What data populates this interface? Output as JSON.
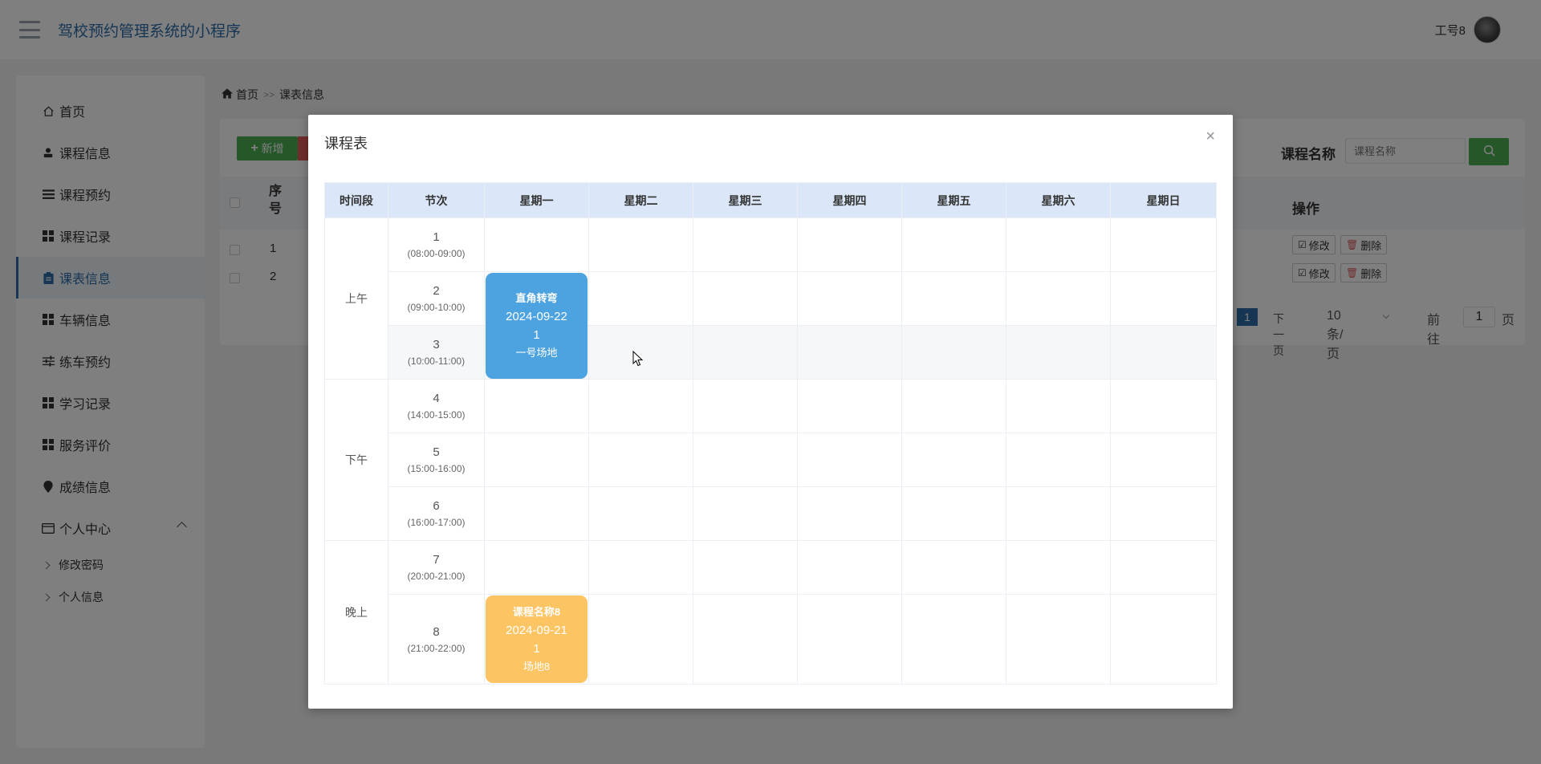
{
  "header": {
    "title": "驾校预约管理系统的小程序",
    "username": "工号8"
  },
  "sidebar": {
    "items": [
      {
        "label": "首页",
        "icon": "home-icon"
      },
      {
        "label": "课程信息",
        "icon": "user-icon"
      },
      {
        "label": "课程预约",
        "icon": "list-icon"
      },
      {
        "label": "课程记录",
        "icon": "grid-icon"
      },
      {
        "label": "课表信息",
        "icon": "clipboard-icon",
        "active": true
      },
      {
        "label": "车辆信息",
        "icon": "grid-icon"
      },
      {
        "label": "练车预约",
        "icon": "sliders-icon"
      },
      {
        "label": "学习记录",
        "icon": "grid-icon"
      },
      {
        "label": "服务评价",
        "icon": "grid-icon"
      },
      {
        "label": "成绩信息",
        "icon": "pin-icon"
      },
      {
        "label": "个人中心",
        "icon": "card-icon"
      }
    ],
    "sub_items": [
      {
        "label": "修改密码"
      },
      {
        "label": "个人信息"
      }
    ]
  },
  "breadcrumb": {
    "home": "首页",
    "separator": ">>",
    "current": "课表信息"
  },
  "toolbar": {
    "add_label": "新增",
    "search_label": "课程名称",
    "search_placeholder": "课程名称"
  },
  "list": {
    "col_seq": "序号",
    "col_op": "操作",
    "rows": [
      {
        "num": "1",
        "edit": "修改",
        "delete": "删除"
      },
      {
        "num": "2",
        "edit": "修改",
        "delete": "删除"
      }
    ]
  },
  "pager": {
    "current": "1",
    "next": "下一页",
    "size": "10条/页",
    "goto": "前往",
    "goto_value": "1",
    "page_suffix": "页"
  },
  "modal": {
    "title": "课程表",
    "close": "×",
    "headers": [
      "时间段",
      "节次",
      "星期一",
      "星期二",
      "星期三",
      "星期四",
      "星期五",
      "星期六",
      "星期日"
    ],
    "periods": [
      "上午",
      "下午",
      "晚上"
    ],
    "sections": [
      {
        "num": "1",
        "time": "(08:00-09:00)"
      },
      {
        "num": "2",
        "time": "(09:00-10:00)"
      },
      {
        "num": "3",
        "time": "(10:00-11:00)"
      },
      {
        "num": "4",
        "time": "(14:00-15:00)"
      },
      {
        "num": "5",
        "time": "(15:00-16:00)"
      },
      {
        "num": "6",
        "time": "(16:00-17:00)"
      },
      {
        "num": "7",
        "time": "(20:00-21:00)"
      },
      {
        "num": "8",
        "time": "(21:00-22:00)"
      }
    ],
    "courses": [
      {
        "name": "直角转弯",
        "date": "2024-09-22",
        "count": "1",
        "venue": "一号场地",
        "color": "#4da3e0"
      },
      {
        "name": "课程名称8",
        "date": "2024-09-21",
        "count": "1",
        "venue": "场地8",
        "color": "#fdc463"
      }
    ]
  },
  "colors": {
    "brand": "#2d6da8",
    "success": "#4caf50",
    "danger": "#e05a5a"
  }
}
